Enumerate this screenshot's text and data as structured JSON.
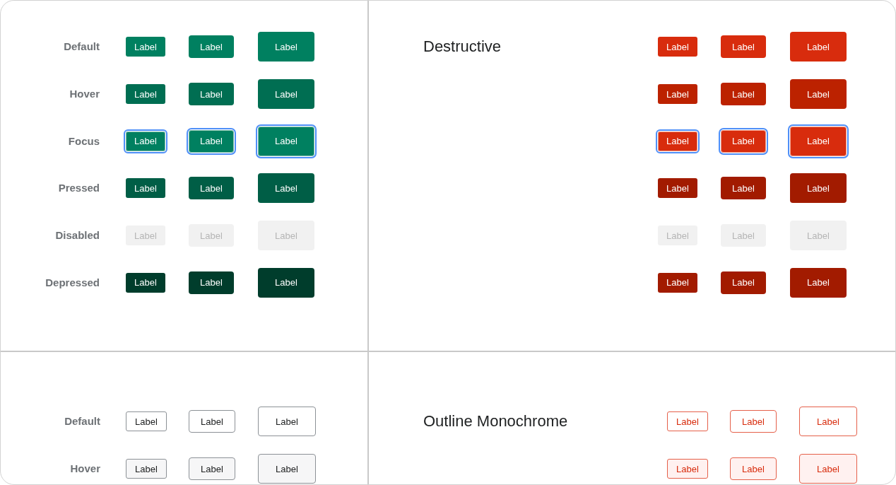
{
  "panels": [
    {
      "kind": "primary",
      "rows": [
        {
          "kind": "default",
          "label": "Default",
          "buttons": [
            {
              "label": "Label",
              "kind": "small"
            },
            {
              "label": "Label",
              "kind": "medium"
            },
            {
              "label": "Label",
              "kind": "large"
            }
          ]
        },
        {
          "kind": "hover",
          "label": "Hover",
          "buttons": [
            {
              "label": "Label",
              "kind": "small"
            },
            {
              "label": "Label",
              "kind": "medium"
            },
            {
              "label": "Label",
              "kind": "large"
            }
          ]
        },
        {
          "kind": "focus",
          "label": "Focus",
          "buttons": [
            {
              "label": "Label",
              "kind": "small"
            },
            {
              "label": "Label",
              "kind": "medium"
            },
            {
              "label": "Label",
              "kind": "large"
            }
          ]
        },
        {
          "kind": "pressed",
          "label": "Pressed",
          "buttons": [
            {
              "label": "Label",
              "kind": "small"
            },
            {
              "label": "Label",
              "kind": "medium"
            },
            {
              "label": "Label",
              "kind": "large"
            }
          ]
        },
        {
          "kind": "disabled",
          "label": "Disabled",
          "buttons": [
            {
              "label": "Label",
              "kind": "small"
            },
            {
              "label": "Label",
              "kind": "medium"
            },
            {
              "label": "Label",
              "kind": "large"
            }
          ]
        },
        {
          "kind": "depressed",
          "label": "Depressed",
          "buttons": [
            {
              "label": "Label",
              "kind": "small"
            },
            {
              "label": "Label",
              "kind": "medium"
            },
            {
              "label": "Label",
              "kind": "large"
            }
          ]
        }
      ]
    },
    {
      "kind": "destructive",
      "title": "Destructive",
      "rows": [
        {
          "kind": "default",
          "buttons": [
            {
              "label": "Label",
              "kind": "small"
            },
            {
              "label": "Label",
              "kind": "medium"
            },
            {
              "label": "Label",
              "kind": "large"
            }
          ]
        },
        {
          "kind": "hover",
          "buttons": [
            {
              "label": "Label",
              "kind": "small"
            },
            {
              "label": "Label",
              "kind": "medium"
            },
            {
              "label": "Label",
              "kind": "large"
            }
          ]
        },
        {
          "kind": "focus",
          "buttons": [
            {
              "label": "Label",
              "kind": "small"
            },
            {
              "label": "Label",
              "kind": "medium"
            },
            {
              "label": "Label",
              "kind": "large"
            }
          ]
        },
        {
          "kind": "pressed",
          "buttons": [
            {
              "label": "Label",
              "kind": "small"
            },
            {
              "label": "Label",
              "kind": "medium"
            },
            {
              "label": "Label",
              "kind": "large"
            }
          ]
        },
        {
          "kind": "disabled",
          "buttons": [
            {
              "label": "Label",
              "kind": "small"
            },
            {
              "label": "Label",
              "kind": "medium"
            },
            {
              "label": "Label",
              "kind": "large"
            }
          ]
        },
        {
          "kind": "depressed",
          "buttons": [
            {
              "label": "Label",
              "kind": "small"
            },
            {
              "label": "Label",
              "kind": "medium"
            },
            {
              "label": "Label",
              "kind": "large"
            }
          ]
        }
      ]
    },
    {
      "kind": "outline",
      "rows": [
        {
          "kind": "default",
          "label": "Default",
          "buttons": [
            {
              "label": "Label",
              "kind": "small"
            },
            {
              "label": "Label",
              "kind": "medium"
            },
            {
              "label": "Label",
              "kind": "large"
            }
          ]
        },
        {
          "kind": "hover",
          "label": "Hover",
          "buttons": [
            {
              "label": "Label",
              "kind": "small"
            },
            {
              "label": "Label",
              "kind": "medium"
            },
            {
              "label": "Label",
              "kind": "large"
            }
          ]
        }
      ]
    },
    {
      "kind": "outlinered",
      "title": "Outline Monochrome",
      "rows": [
        {
          "kind": "default",
          "buttons": [
            {
              "label": "Label",
              "kind": "small"
            },
            {
              "label": "Label",
              "kind": "medium"
            },
            {
              "label": "Label",
              "kind": "large"
            }
          ]
        },
        {
          "kind": "hover",
          "buttons": [
            {
              "label": "Label",
              "kind": "small"
            },
            {
              "label": "Label",
              "kind": "medium"
            },
            {
              "label": "Label",
              "kind": "large"
            }
          ]
        }
      ]
    }
  ]
}
